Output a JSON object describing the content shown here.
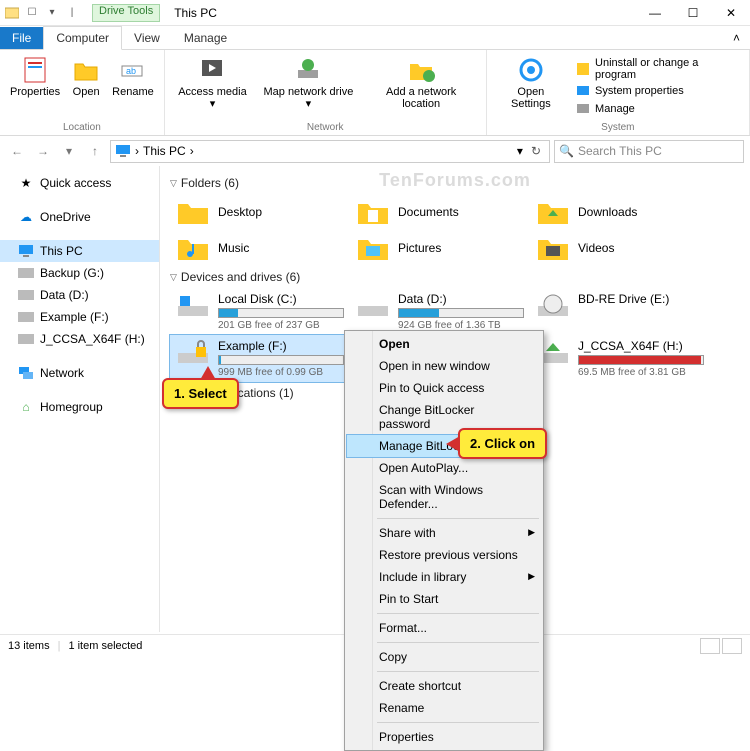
{
  "titlebar": {
    "tool_tab": "Drive Tools",
    "title": "This PC",
    "min": "—",
    "max": "☐",
    "close": "✕"
  },
  "tabs": {
    "file": "File",
    "computer": "Computer",
    "view": "View",
    "manage": "Manage"
  },
  "ribbon": {
    "location": {
      "properties": "Properties",
      "open": "Open",
      "rename": "Rename",
      "group": "Location"
    },
    "network": {
      "access_media": "Access media ▾",
      "map_drive": "Map network drive ▾",
      "add_location": "Add a network location",
      "group": "Network"
    },
    "system": {
      "open_settings": "Open Settings",
      "uninstall": "Uninstall or change a program",
      "sysprops": "System properties",
      "manage": "Manage",
      "group": "System"
    }
  },
  "address": {
    "crumb": "This PC",
    "arrow": "›"
  },
  "search": {
    "placeholder": "Search This PC"
  },
  "nav": {
    "quick_access": "Quick access",
    "onedrive": "OneDrive",
    "this_pc": "This PC",
    "backup": "Backup (G:)",
    "data": "Data (D:)",
    "example": "Example (F:)",
    "jccsa": "J_CCSA_X64F (H:)",
    "network": "Network",
    "homegroup": "Homegroup"
  },
  "sections": {
    "folders": "Folders (6)",
    "drives": "Devices and drives (6)",
    "netloc": "Network locations (1)"
  },
  "folders": {
    "desktop": "Desktop",
    "documents": "Documents",
    "downloads": "Downloads",
    "music": "Music",
    "pictures": "Pictures",
    "videos": "Videos"
  },
  "drives": {
    "c": {
      "name": "Local Disk (C:)",
      "sub": "201 GB free of 237 GB",
      "fill": 15
    },
    "d": {
      "name": "Data (D:)",
      "sub": "924 GB free of 1.36 TB",
      "fill": 32
    },
    "bd": {
      "name": "BD-RE Drive (E:)",
      "sub": "",
      "fill": 0
    },
    "f": {
      "name": "Example (F:)",
      "sub": "999 MB free of 0.99 GB",
      "fill": 2
    },
    "g": {
      "name": "Backup (G:)",
      "sub": "",
      "fill": 0
    },
    "h": {
      "name": "J_CCSA_X64F (H:)",
      "sub": "69.5 MB free of 3.81 GB",
      "fill": 98
    }
  },
  "ctx": {
    "open": "Open",
    "open_new": "Open in new window",
    "pin_qa": "Pin to Quick access",
    "change_bl": "Change BitLocker password",
    "manage_bl": "Manage BitLocker",
    "autoplay": "Open AutoPlay...",
    "scan": "Scan with Windows Defender...",
    "share": "Share with",
    "restore": "Restore previous versions",
    "include": "Include in library",
    "pin_start": "Pin to Start",
    "format": "Format...",
    "copy": "Copy",
    "shortcut": "Create shortcut",
    "rename": "Rename",
    "properties": "Properties"
  },
  "callouts": {
    "c1": "1. Select",
    "c2": "2. Click on"
  },
  "status": {
    "items": "13 items",
    "selected": "1 item selected"
  },
  "watermark": "TenForums.com"
}
